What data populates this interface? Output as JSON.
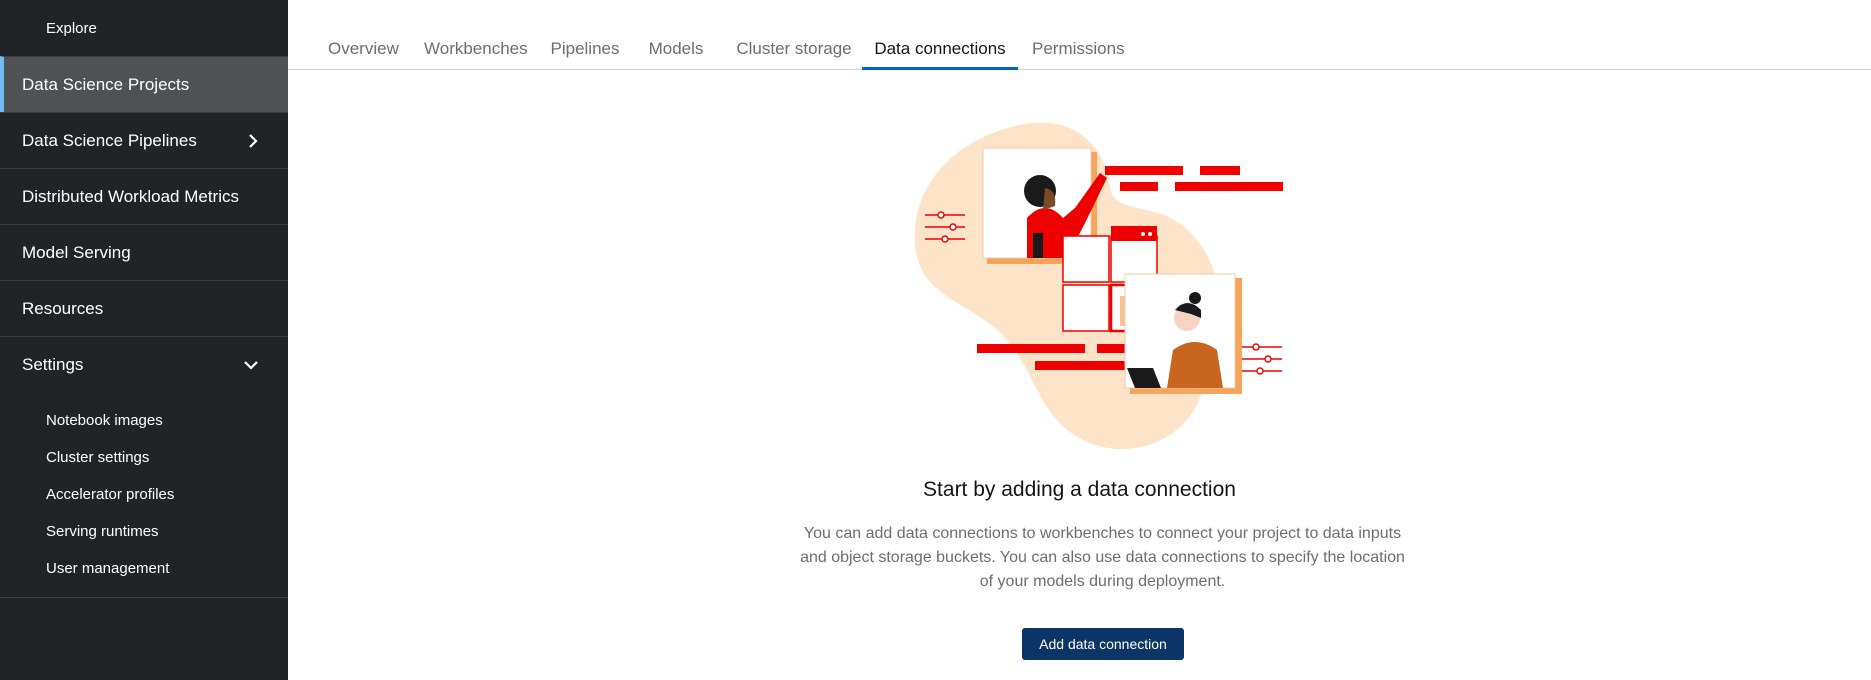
{
  "sidebar": {
    "top_item": "Explore",
    "items": [
      {
        "label": "Data Science Projects",
        "active": true
      },
      {
        "label": "Data Science Pipelines",
        "chevron": "chevron-right-icon"
      },
      {
        "label": "Distributed Workload Metrics"
      },
      {
        "label": "Model Serving"
      },
      {
        "label": "Resources"
      },
      {
        "label": "Settings",
        "chevron": "chevron-down-icon"
      }
    ],
    "settings_subitems": [
      "Notebook images",
      "Cluster settings",
      "Accelerator profiles",
      "Serving runtimes",
      "User management"
    ]
  },
  "tabs": [
    {
      "label": "Overview"
    },
    {
      "label": "Workbenches"
    },
    {
      "label": "Pipelines"
    },
    {
      "label": "Models"
    },
    {
      "label": "Cluster storage"
    },
    {
      "label": "Data connections",
      "active": true
    },
    {
      "label": "Permissions"
    }
  ],
  "empty_state": {
    "title": "Start by adding a data connection",
    "body": "You can add data connections to workbenches to connect your project to data inputs and object storage buckets. You can also use data connections to specify the location of your models during deployment.",
    "button": "Add data connection"
  },
  "colors": {
    "sidebar_bg": "#212427",
    "active_item_bg": "#4f5255",
    "active_indicator": "#73bcf7",
    "tab_active_underline": "#0066cc",
    "primary_button": "#0b3566",
    "illustration_red": "#ee0000",
    "illustration_peach": "#fde3c8"
  }
}
